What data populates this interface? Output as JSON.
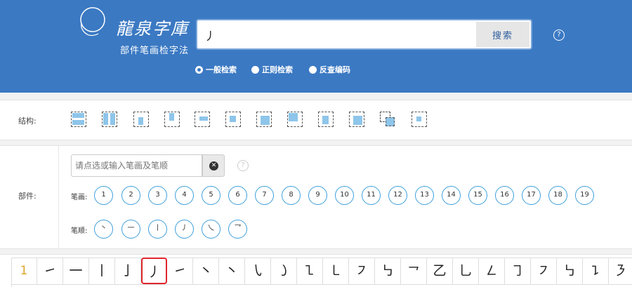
{
  "header": {
    "title": "龍泉字庫",
    "subtitle": "部件笔画检字法",
    "search_value": "丿",
    "search_button": "搜索",
    "help": "?",
    "modes": [
      {
        "label": "一般检索",
        "selected": true
      },
      {
        "label": "正则检索",
        "selected": false
      },
      {
        "label": "反查编码",
        "selected": false
      }
    ],
    "colors": {
      "brand": "#3b79c3",
      "accent": "#3fa0dc",
      "highlight": "#e0262c"
    }
  },
  "structure": {
    "label": "结构:",
    "icons": [
      "structure-top-bottom",
      "structure-left-right",
      "structure-enclose-bottom",
      "structure-enclose-top",
      "structure-enclose-left-open",
      "structure-enclose-bottom-open",
      "structure-enclose-top-left",
      "structure-enclose-bottom-left",
      "structure-enclose-right-open",
      "structure-enclose-top-right",
      "structure-overlap",
      "structure-full-enclose"
    ]
  },
  "components": {
    "label": "部件:",
    "input_placeholder": "请点选或输入笔画及笔顺",
    "help": "?",
    "stroke_count_label": "笔画:",
    "stroke_counts": [
      "1",
      "2",
      "3",
      "4",
      "5",
      "6",
      "7",
      "8",
      "9",
      "10",
      "11",
      "12",
      "13",
      "14",
      "15",
      "16",
      "17",
      "18",
      "19"
    ],
    "stroke_order_label": "笔顺:",
    "stroke_orders": [
      "丶",
      "一",
      "丨",
      "丿",
      "乀",
      "乛"
    ]
  },
  "results": {
    "count": "1",
    "chars": [
      "㇀",
      "一",
      "丨",
      "亅",
      "丿",
      "㇀",
      "㇔",
      "丶",
      "㇂",
      "㇁",
      "㇅",
      "㇄",
      "㇇",
      "㇉",
      "㇖",
      "乙",
      "乚",
      "㇜",
      "㇆",
      "㇇",
      "㇉",
      "㇊",
      "㇋"
    ],
    "selected_index": 4
  }
}
